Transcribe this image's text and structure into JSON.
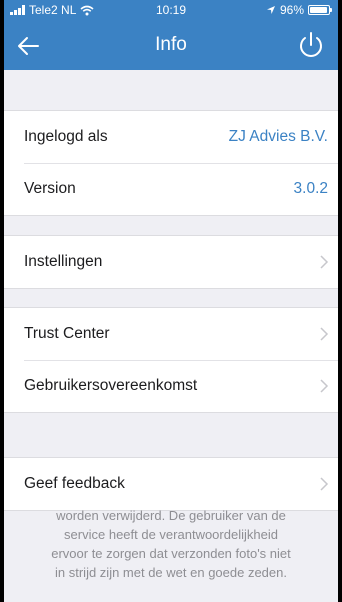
{
  "status_bar": {
    "carrier": "Tele2 NL",
    "time": "10:19",
    "battery_percent": "96%",
    "battery_level": 0.96,
    "wifi_icon": "wifi-icon",
    "location_icon": "location-arrow-icon"
  },
  "nav": {
    "title": "Info",
    "back_icon": "arrow-left-icon",
    "power_icon": "power-icon"
  },
  "account": {
    "logged_in_label": "Ingelogd als",
    "logged_in_value": "ZJ Advies B.V.",
    "version_label": "Version",
    "version_value": "3.0.2"
  },
  "settings": {
    "label": "Instellingen"
  },
  "legal": {
    "trust_center_label": "Trust Center",
    "user_agreement_label": "Gebruikersovereenkomst"
  },
  "feedback": {
    "label": "Geef feedback"
  },
  "footer": {
    "line1": "worden verwijderd. De gebruiker van de",
    "line2": "service heeft de verantwoordelijkheid",
    "line3": "ervoor te zorgen dat verzonden foto's niet",
    "line4": "in strijd zijn met de wet en goede zeden."
  },
  "colors": {
    "accent": "#3b82c4",
    "background": "#efeff4"
  }
}
